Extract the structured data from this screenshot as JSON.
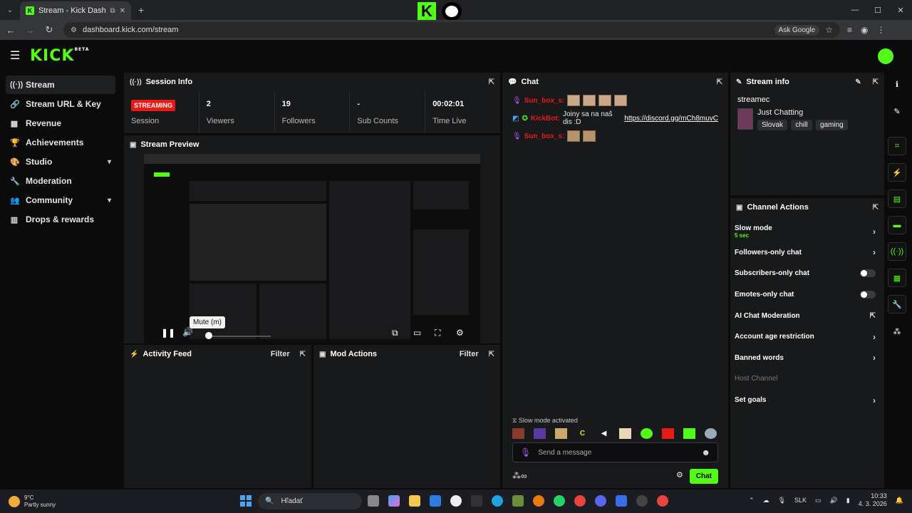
{
  "browser": {
    "tab_title": "Stream - Kick Dashboard",
    "url": "dashboard.kick.com/stream",
    "ask_google": "Ask Google"
  },
  "app": {
    "logo": "KICK",
    "logo_beta": "BETA"
  },
  "sidebar": {
    "items": [
      {
        "label": "Stream",
        "icon": "stream-icon"
      },
      {
        "label": "Stream URL & Key",
        "icon": "link-icon"
      },
      {
        "label": "Revenue",
        "icon": "chart-icon"
      },
      {
        "label": "Achievements",
        "icon": "trophy-icon"
      },
      {
        "label": "Studio",
        "icon": "palette-icon"
      },
      {
        "label": "Moderation",
        "icon": "wrench-icon"
      },
      {
        "label": "Community",
        "icon": "users-icon"
      },
      {
        "label": "Drops & rewards",
        "icon": "gift-icon"
      }
    ]
  },
  "session": {
    "title": "Session Info",
    "status_badge": "STREAMING",
    "stats": [
      {
        "value": "",
        "label": "Session"
      },
      {
        "value": "2",
        "label": "Viewers"
      },
      {
        "value": "19",
        "label": "Followers"
      },
      {
        "value": "-",
        "label": "Sub Counts"
      },
      {
        "value": "00:02:01",
        "label": "Time Live"
      }
    ]
  },
  "preview": {
    "title": "Stream Preview",
    "tooltip": "Mute (m)"
  },
  "activity": {
    "title": "Activity Feed",
    "filter": "Filter"
  },
  "mod_actions": {
    "title": "Mod Actions",
    "filter": "Filter"
  },
  "chat": {
    "title": "Chat",
    "messages": [
      {
        "user": "Sun_box_s:",
        "text": ""
      },
      {
        "user": "KickBot:",
        "text": "Joiny sa na naš dis :D",
        "link": "https://discord.gg/mCh8muvC"
      },
      {
        "user": "Sun_box_s:",
        "text": ""
      }
    ],
    "slow_mode_note": "Slow mode activated",
    "placeholder": "Send a message",
    "send_label": "Chat"
  },
  "stream_info": {
    "title": "Stream info",
    "username": "streamec",
    "category": "Just Chatting",
    "tags": [
      "Slovak",
      "chill",
      "gaming"
    ]
  },
  "channel_actions": {
    "title": "Channel Actions",
    "items": [
      {
        "label": "Slow mode",
        "sub": "5 sec"
      },
      {
        "label": "Followers-only chat"
      },
      {
        "label": "Subscribers-only chat"
      },
      {
        "label": "Emotes-only chat"
      },
      {
        "label": "AI Chat Moderation"
      },
      {
        "label": "Account age restriction"
      },
      {
        "label": "Banned words"
      },
      {
        "label": "Host Channel"
      },
      {
        "label": "Set goals"
      }
    ]
  },
  "taskbar": {
    "temp": "9°C",
    "weather": "Partly sunny",
    "search": "Hľadať",
    "lang": "SLK",
    "time": "10:33",
    "date": "4. 3. 2026"
  },
  "colors": {
    "accent": "#53fc18",
    "live": "#e91916",
    "panel": "#18191b"
  }
}
